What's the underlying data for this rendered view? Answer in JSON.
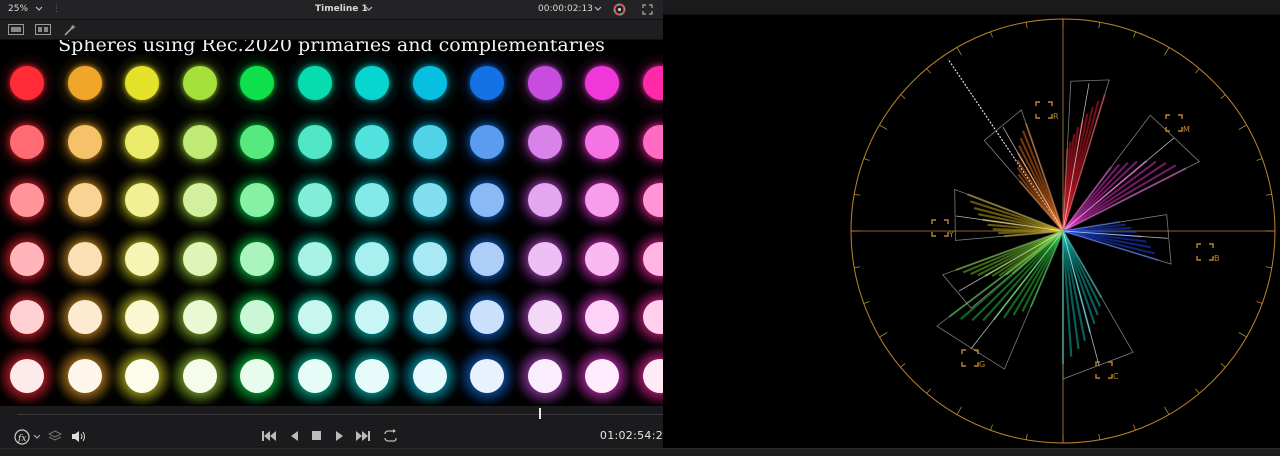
{
  "viewer": {
    "zoom": "25%",
    "timeline_name": "Timeline 1",
    "source_timecode": "00:00:02:13",
    "frame_title": "Spheres using Rec.2020 primaries and complementaries",
    "playhead_timecode": "01:02:54:2"
  },
  "grid": {
    "columns": [
      "#ff2b37",
      "#f0a628",
      "#e3e12a",
      "#a5e03a",
      "#0de04a",
      "#07dcae",
      "#07d5d0",
      "#07bfe0",
      "#1472e6",
      "#c84ce0",
      "#f038d8",
      "#ff2aa8"
    ],
    "row_lightness": [
      0,
      0.3,
      0.5,
      0.65,
      0.78,
      0.9
    ]
  },
  "scope": {
    "targets": [
      "R",
      "M",
      "Y",
      "B",
      "G",
      "C"
    ],
    "ring_color": "#b8862e"
  },
  "icons": {
    "zoom_dropdown": "chevron-down-icon",
    "timeline_dropdown": "chevron-down-icon",
    "timecode_dropdown": "chevron-down-icon",
    "color_wheel": "color-wheel-icon",
    "fullscreen": "fullscreen-icon",
    "single_viewer": "single-viewer-icon",
    "dual_viewer": "dual-viewer-icon",
    "magic_wand": "magic-wand-icon",
    "fx": "fx-icon",
    "layers": "layers-icon",
    "volume": "volume-icon",
    "first_frame": "first-frame-icon",
    "play_reverse": "play-reverse-icon",
    "stop": "stop-icon",
    "play": "play-icon",
    "last_frame": "last-frame-icon",
    "loop": "loop-icon"
  }
}
